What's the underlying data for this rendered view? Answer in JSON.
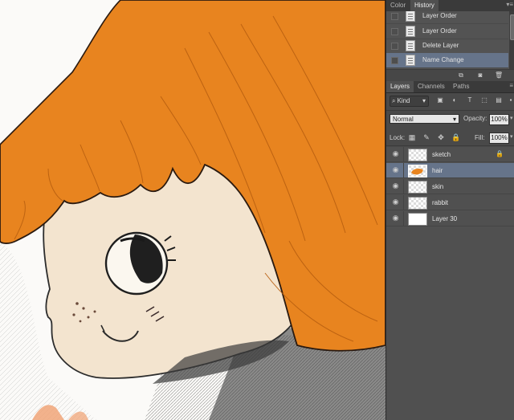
{
  "history_panel": {
    "tabs": [
      {
        "label": "Color",
        "active": false
      },
      {
        "label": "History",
        "active": true
      }
    ],
    "items": [
      {
        "label": "Layer Order",
        "selected": false
      },
      {
        "label": "Layer Order",
        "selected": false
      },
      {
        "label": "Delete Layer",
        "selected": false
      },
      {
        "label": "Name Change",
        "selected": true
      }
    ],
    "footer_icons": [
      "new-snapshot-icon",
      "camera-icon",
      "trash-icon"
    ]
  },
  "layers_panel": {
    "tabs": [
      {
        "label": "Layers",
        "active": true
      },
      {
        "label": "Channels",
        "active": false
      },
      {
        "label": "Paths",
        "active": false
      }
    ],
    "filter": {
      "label": "Kind"
    },
    "blend_mode": "Normal",
    "opacity_label": "Opacity:",
    "opacity_value": "100%",
    "lock_label": "Lock:",
    "fill_label": "Fill:",
    "fill_value": "100%",
    "layers": [
      {
        "name": "sketch",
        "visible": true,
        "locked": true,
        "selected": false,
        "thumb": "transparent"
      },
      {
        "name": "hair",
        "visible": true,
        "locked": false,
        "selected": true,
        "thumb": "hair"
      },
      {
        "name": "skin",
        "visible": true,
        "locked": false,
        "selected": false,
        "thumb": "transparent"
      },
      {
        "name": "rabbit",
        "visible": true,
        "locked": false,
        "selected": false,
        "thumb": "transparent"
      },
      {
        "name": "Layer 30",
        "visible": true,
        "locked": false,
        "selected": false,
        "thumb": "white"
      }
    ]
  },
  "colors": {
    "hair_orange": "#e8841f",
    "skin_beige": "#f3e4cf",
    "panel_bg": "#494949",
    "selection_blue": "#66748a"
  }
}
